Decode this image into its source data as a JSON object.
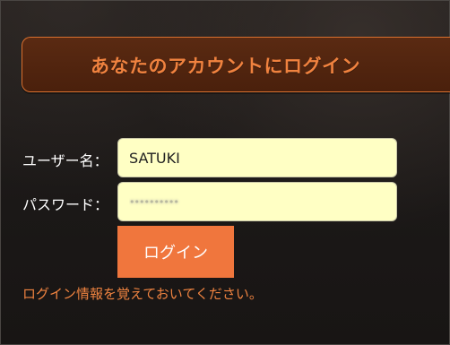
{
  "header": {
    "title": "あなたのアカウントにログイン"
  },
  "form": {
    "username_label": "ユーザー名：",
    "username_value": "SATUKI",
    "password_label": "パスワード：",
    "password_value": "••••••••••",
    "submit_label": "ログイン",
    "remember_label": "ログイン情報を覚えておいてください。"
  },
  "colors": {
    "accent": "#f0763d",
    "header_bg": "#4f240e",
    "input_bg": "#ffffc4",
    "link": "#ef8340"
  }
}
